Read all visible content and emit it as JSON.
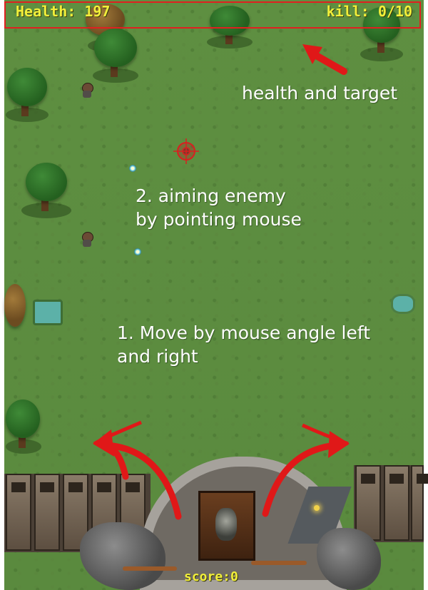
{
  "hud": {
    "health_text": "Health: 197",
    "kills_text": "kill: 0/10",
    "score_text": "score:0",
    "frame_color": "#e02020",
    "text_color": "#f2ef3a"
  },
  "annotations": {
    "health_target": "health and target",
    "aim_line1": "2. aiming enemy",
    "aim_line2": "by pointing mouse",
    "move_line1": "1. Move by mouse angle left",
    "move_line2": "and right",
    "arrow_color": "#e01818"
  },
  "icons": {
    "crosshair": "crosshair-icon",
    "enemy": "enemy-soldier-icon",
    "gem": "gem-icon",
    "player": "player-archer-icon"
  }
}
